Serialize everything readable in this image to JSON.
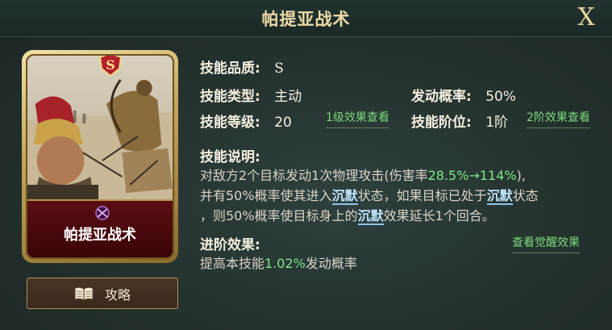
{
  "header": {
    "title": "帕提亚战术",
    "close_label": "X"
  },
  "card": {
    "name": "帕提亚战术",
    "grade_badge": "S"
  },
  "guide_button": {
    "label": "攻略"
  },
  "info": {
    "quality_label": "技能品质:",
    "quality_value": "S",
    "type_label": "技能类型:",
    "type_value": "主动",
    "trigger_label": "发动概率:",
    "trigger_value": "50%",
    "level_label": "技能等级:",
    "level_value": "20",
    "level_link": "1级效果查看",
    "tier_label": "技能阶位:",
    "tier_value": "1阶",
    "tier_link": "2阶效果查看"
  },
  "description": {
    "title": "技能说明:",
    "line1_a": "对敌方2个目标发动1次物理攻击(伤害率",
    "line1_hl": "28.5%→114%",
    "line1_b": "),",
    "line2_a": "并有50%概率使其进入",
    "keyword": "沉默",
    "line2_b": "状态，如果目标已处于",
    "line2_c": "状态",
    "line3_a": "，则50%概率使目标身上的",
    "line3_b": "效果延长1个回合。"
  },
  "advance": {
    "title": "进阶效果:",
    "link": "查看觉醒效果",
    "text_a": "提高本技能",
    "text_hl": "1.02%",
    "text_b": "发动概率"
  },
  "colors": {
    "accent_gold": "#ecd9a8",
    "highlight_green": "#7be884",
    "keyword_blue": "#bfe6ff",
    "card_red": "#5a0d12"
  }
}
